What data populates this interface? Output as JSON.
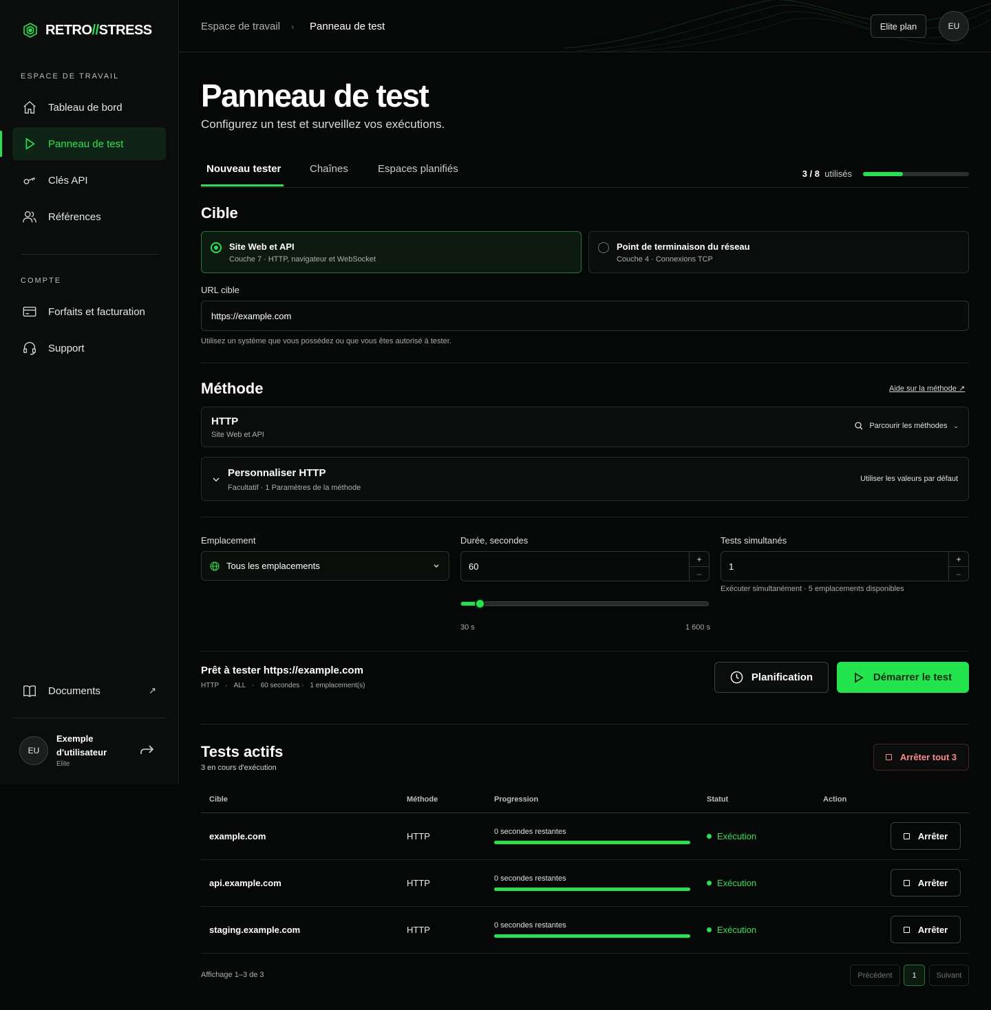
{
  "brand": {
    "name_left": "RETRO",
    "slashes": "//",
    "name_right": "STRESS"
  },
  "sidebar": {
    "workspace_heading": "ESPACE DE TRAVAIL",
    "items": [
      {
        "label": "Tableau de bord",
        "icon": "home-icon"
      },
      {
        "label": "Panneau de test",
        "icon": "play-icon",
        "active": true
      },
      {
        "label": "Clés API",
        "icon": "key-icon"
      },
      {
        "label": "Références",
        "icon": "users-icon"
      }
    ],
    "account_heading": "COMPTE",
    "account_items": [
      {
        "label": "Forfaits et facturation",
        "icon": "credit-card-icon"
      },
      {
        "label": "Support",
        "icon": "headset-icon"
      }
    ],
    "docs_label": "Documents",
    "user": {
      "initials": "EU",
      "name_line1": "Exemple",
      "name_line2": "d'utilisateur",
      "plan": "Elite"
    }
  },
  "topbar": {
    "breadcrumb_parent": "Espace de travail",
    "breadcrumb_current": "Panneau de test",
    "plan_button": "Elite plan",
    "avatar_initials": "EU"
  },
  "page": {
    "title": "Panneau de test",
    "subtitle": "Configurez un test et surveillez vos exécutions."
  },
  "tabs": {
    "items": [
      "Nouveau tester",
      "Chaînes",
      "Espaces planifiés"
    ],
    "usage_count": "3 / 8",
    "usage_label": "utilisés",
    "usage_fraction": 0.375
  },
  "target": {
    "heading": "Cible",
    "options": [
      {
        "title": "Site Web et API",
        "sub": "Couche 7 · HTTP, navigateur et WebSocket",
        "selected": true
      },
      {
        "title": "Point de terminaison du réseau",
        "sub": "Couche 4 · Connexions TCP",
        "selected": false
      }
    ],
    "url_label": "URL cible",
    "url_value": "https://example.com",
    "url_hint": "Utilisez un système que vous possédez ou que vous êtes autorisé à tester."
  },
  "method": {
    "heading": "Méthode",
    "help_link": "Aide sur la méthode ↗",
    "selected_name": "HTTP",
    "selected_sub": "Site Web et API",
    "browse_label": "Parcourir les méthodes",
    "customize_title": "Personnaliser HTTP",
    "customize_sub": "Facultatif · 1 Paramètres de la méthode",
    "defaults_label": "Utiliser les valeurs par défaut"
  },
  "settings": {
    "location_label": "Emplacement",
    "location_value": "Tous les emplacements",
    "duration_label": "Durée, secondes",
    "duration_value": "60",
    "duration_min_label": "30 s",
    "duration_max_label": "1 600 s",
    "duration_fraction": 0.018,
    "concurrent_label": "Tests simultanés",
    "concurrent_value": "1",
    "concurrent_hint": "Exécuter simultanément · 5 emplacements disponibles"
  },
  "ready": {
    "title": "Prêt à tester https://example.com",
    "meta": [
      "HTTP",
      "·",
      "ALL",
      "·",
      "60 secondes ·",
      "1 emplacement(s)"
    ],
    "schedule_button": "Planification",
    "start_button": "Démarrer le test"
  },
  "active": {
    "heading": "Tests actifs",
    "sub": "3 en cours d'exécution",
    "stop_all": "Arrêter tout 3",
    "columns": [
      "Cible",
      "Méthode",
      "Progression",
      "Statut",
      "Action"
    ],
    "rows": [
      {
        "target": "example.com",
        "method": "HTTP",
        "progress_text": "0 secondes restantes",
        "progress": 1.0,
        "status": "Exécution",
        "action": "Arrêter"
      },
      {
        "target": "api.example.com",
        "method": "HTTP",
        "progress_text": "0 secondes restantes",
        "progress": 1.0,
        "status": "Exécution",
        "action": "Arrêter"
      },
      {
        "target": "staging.example.com",
        "method": "HTTP",
        "progress_text": "0 secondes restantes",
        "progress": 1.0,
        "status": "Exécution",
        "action": "Arrêter"
      }
    ],
    "showing": "Affichage 1–3 de 3",
    "prev": "Précédent",
    "page": "1",
    "next": "Suivant"
  },
  "colors": {
    "accent": "#22e54e",
    "background": "#060807",
    "danger": "#ff8a8a"
  }
}
